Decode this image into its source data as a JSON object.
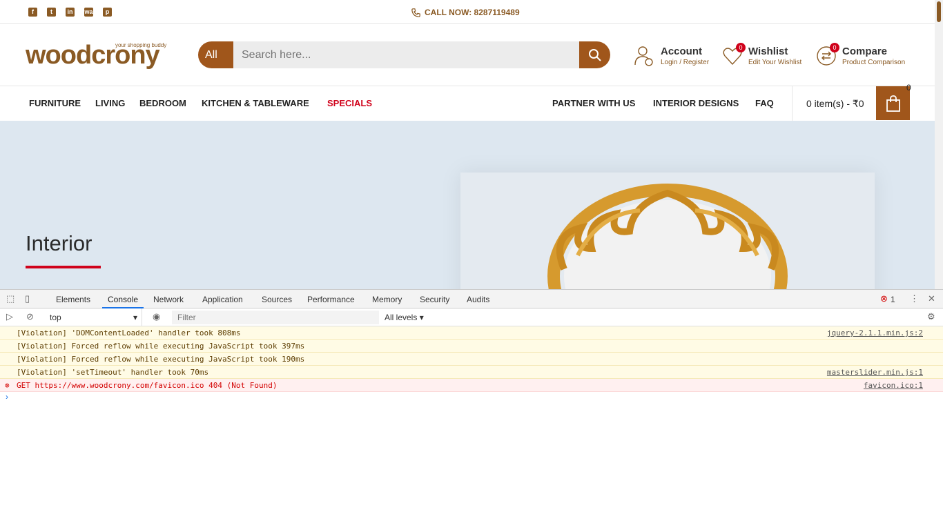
{
  "topbar": {
    "social": [
      "f",
      "t",
      "in",
      "wa",
      "p"
    ],
    "call_now": "CALL NOW: 8287119489"
  },
  "header": {
    "logo_text": "woodcrony",
    "logo_tagline": "your shopping buddy",
    "search_category": "All",
    "search_placeholder": "Search here...",
    "account_title": "Account",
    "account_sub": "Login / Register",
    "wishlist_title": "Wishlist",
    "wishlist_sub": "Edit Your Wishlist",
    "wishlist_count": "0",
    "compare_title": "Compare",
    "compare_sub": "Product Comparison",
    "compare_count": "0"
  },
  "nav": {
    "left": [
      "FURNITURE",
      "LIVING",
      "BEDROOM",
      "KITCHEN & TABLEWARE",
      "SPECIALS"
    ],
    "right": [
      "PARTNER WITH US",
      "INTERIOR DESIGNS",
      "FAQ"
    ],
    "cart_text": "0 item(s) - ₹0",
    "cart_count": "0"
  },
  "hero": {
    "title": "Interior"
  },
  "devtools": {
    "tabs": [
      "Elements",
      "Console",
      "Network",
      "Application",
      "Sources",
      "Performance",
      "Memory",
      "Security",
      "Audits"
    ],
    "active_tab": "Console",
    "error_count": "1",
    "context": "top",
    "filter_placeholder": "Filter",
    "levels": "All levels",
    "messages": [
      {
        "text": "[Violation] 'DOMContentLoaded' handler took 808ms",
        "src": "jquery-2.1.1.min.js:2"
      },
      {
        "text": "[Violation] Forced reflow while executing JavaScript took 397ms",
        "src": ""
      },
      {
        "text": "[Violation] Forced reflow while executing JavaScript took 190ms",
        "src": ""
      },
      {
        "text": "[Violation] 'setTimeout' handler took 70ms",
        "src": "masterslider.min.js:1"
      }
    ],
    "error": {
      "method": "GET",
      "url": "https://www.woodcrony.com/favicon.ico",
      "status": "404 (Not Found)",
      "src": "favicon.ico:1"
    }
  },
  "colors": {
    "brand": "#a0561b",
    "special": "#d0021b",
    "hero_bg": "#dde7f0"
  }
}
